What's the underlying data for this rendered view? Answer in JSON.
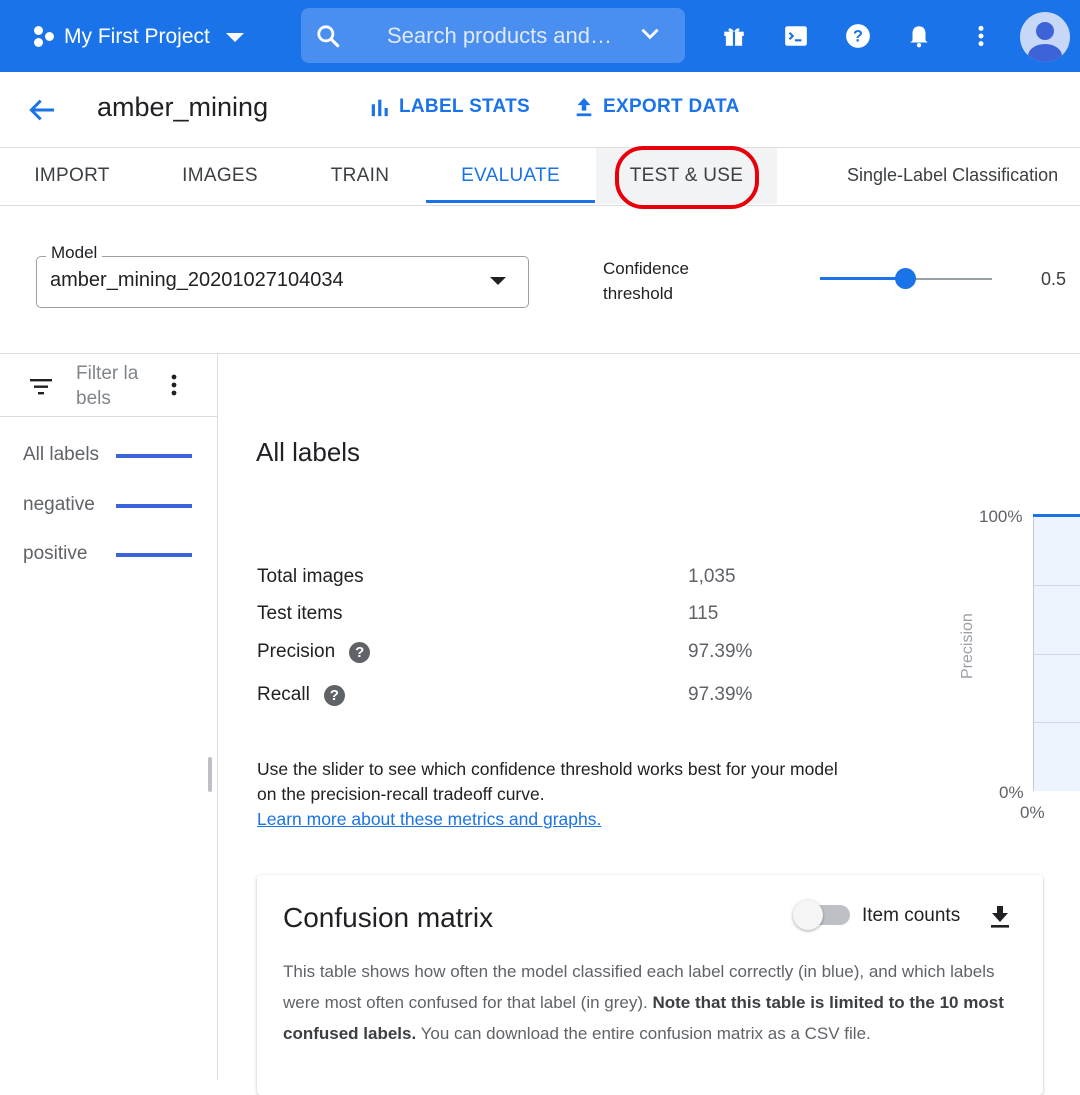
{
  "topbar": {
    "project_name": "My First Project",
    "search_placeholder": "Search products and…",
    "icons": [
      "gift-icon",
      "terminal-icon",
      "help-icon",
      "bell-icon",
      "more-vert-icon",
      "avatar-icon"
    ]
  },
  "header": {
    "title": "amber_mining",
    "label_stats": "LABEL STATS",
    "export_data": "EXPORT DATA"
  },
  "tabs": [
    "IMPORT",
    "IMAGES",
    "TRAIN",
    "EVALUATE",
    "TEST & USE"
  ],
  "active_tab": "EVALUATE",
  "model_type": "Single-Label Classification",
  "model": {
    "label": "Model",
    "value": "amber_mining_20201027104034"
  },
  "confidence": {
    "label": "Confidence threshold",
    "value": "0.5",
    "level": 0.5
  },
  "sidebar": {
    "filter_placeholder": "Filter labels",
    "filter_line1": "Filter la",
    "filter_line2": "bels",
    "labels": [
      "All labels",
      "negative",
      "positive"
    ]
  },
  "main": {
    "heading": "All labels",
    "metrics": [
      {
        "label": "Total images",
        "value": "1,035"
      },
      {
        "label": "Test items",
        "value": "115"
      },
      {
        "label": "Precision",
        "value": "97.39%"
      },
      {
        "label": "Recall",
        "value": "97.39%"
      }
    ],
    "note": "Use the slider to see which confidence threshold works best for your model on the precision-recall tradeoff curve.",
    "learn_more": "Learn more about these metrics and graphs."
  },
  "chart_data": {
    "type": "line",
    "ylabel": "Precision",
    "y_ticks": [
      "100%",
      "0%"
    ],
    "x_ticks": [
      "0%"
    ],
    "ylim": [
      0,
      100
    ]
  },
  "confusion": {
    "title": "Confusion matrix",
    "toggle_label": "Item counts",
    "toggle_on": false,
    "desc_a": "This table shows how often the model classified each label correctly (in blue), and which labels were most often confused for that label (in grey). ",
    "desc_bold": "Note that this table is limited to the 10 most confused labels.",
    "desc_b": " You can download the entire confusion matrix as a CSV file."
  },
  "colors": {
    "brand": "#1a73e8",
    "highlight_circle": "#e8000b"
  }
}
